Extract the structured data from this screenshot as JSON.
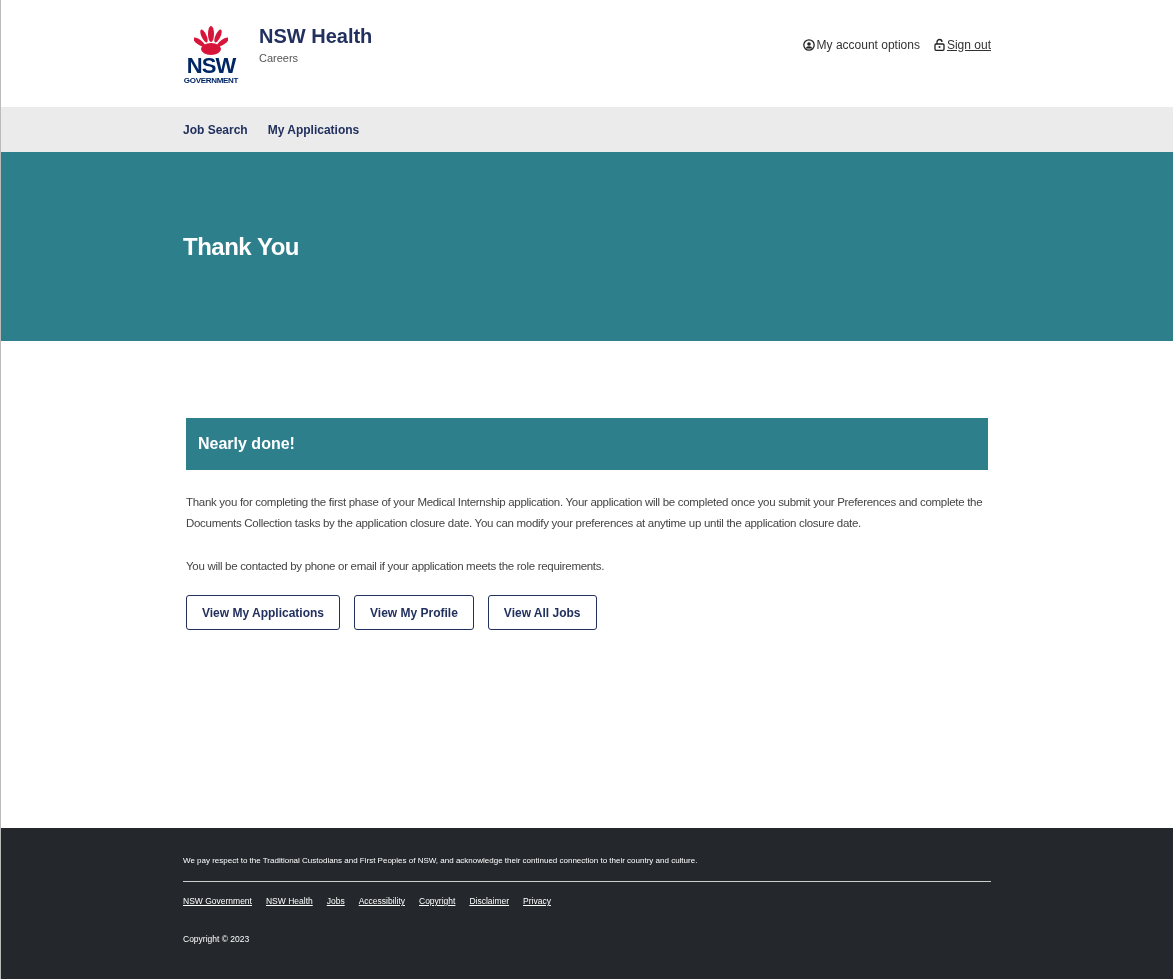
{
  "header": {
    "logo": {
      "wordmark": "NSW",
      "subtitle": "GOVERNMENT"
    },
    "title": "NSW Health",
    "subtitle": "Careers",
    "links": [
      {
        "kind": "account",
        "label": "My account options",
        "underlined": false
      },
      {
        "kind": "signout",
        "label": "Sign out",
        "underlined": true
      }
    ]
  },
  "nav": {
    "items": [
      {
        "label": "Job Search"
      },
      {
        "label": "My Applications"
      }
    ]
  },
  "hero": {
    "title": "Thank You"
  },
  "notice": {
    "title": "Nearly done!",
    "paragraphs": [
      "Thank you for completing the first phase of your Medical Internship application. Your application will be completed once you submit your Preferences and complete the Documents Collection tasks by the application closure date. You can modify your preferences at anytime up until the application closure date.",
      "You will be contacted by phone or email if your application meets the role requirements."
    ],
    "buttons": [
      "View My Applications",
      "View My Profile",
      "View All Jobs"
    ]
  },
  "footer": {
    "acknowledgement": "We pay respect to the Traditional Custodians and First Peoples of NSW, and acknowledge their continued connection to their country and culture.",
    "links": [
      "NSW Government",
      "NSW Health",
      "Jobs",
      "Accessibility",
      "Copyright",
      "Disclaimer",
      "Privacy"
    ],
    "copyright": "Copyright © 2023"
  }
}
